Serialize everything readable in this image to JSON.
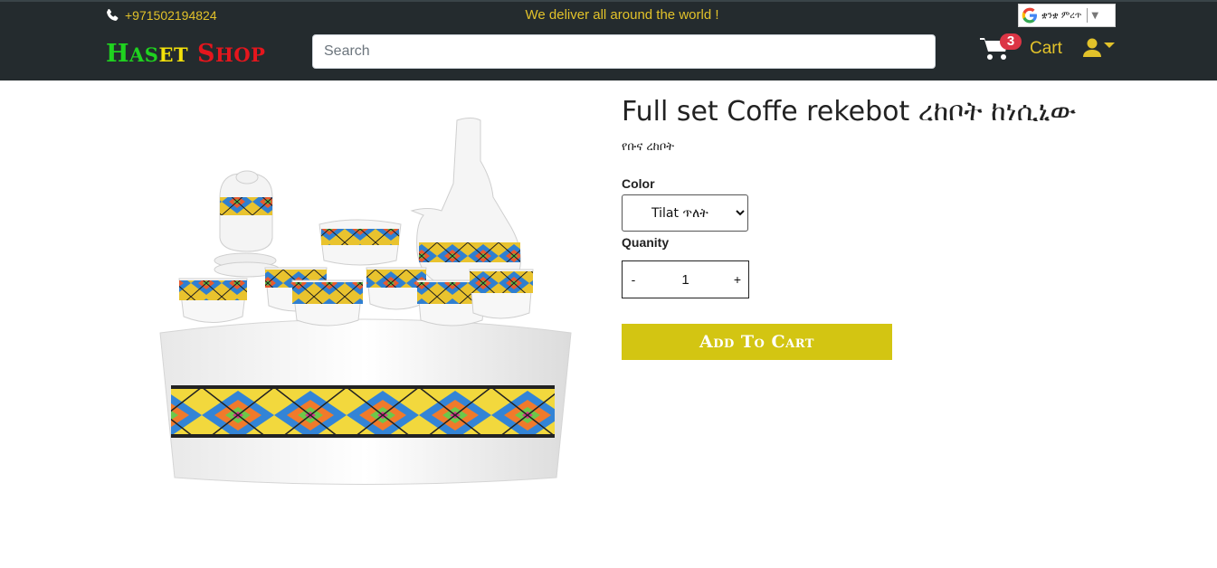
{
  "header": {
    "phone": "+971502194824",
    "tagline": "We deliver all around the world !",
    "translate": {
      "language": "ቋንቋ ምረጥ",
      "arrow": "▼"
    },
    "logo": {
      "part1_first": "H",
      "part1_rest": "AS",
      "part2_rest": "ET",
      "part3_first": " S",
      "part3_rest": "HOP"
    },
    "search": {
      "placeholder": "Search",
      "value": ""
    },
    "cart": {
      "count": "3",
      "label": "Cart"
    },
    "icons": [
      "phone-icon",
      "google-icon",
      "cart-icon",
      "user-icon",
      "caret-down-icon"
    ]
  },
  "product": {
    "title": "Full set Coffe rekebot ረከቦት ከነሲኒው",
    "subtitle": "የቡና ረከቦት",
    "color_label": "Color",
    "color_selected": "Tilat ጥለት",
    "quantity_label": "Quanity",
    "quantity_value": "1",
    "minus": "-",
    "plus": "+",
    "add_to_cart": "Add To Cart"
  },
  "colors": {
    "topbar": "#242b2e",
    "accent": "#e2c22a",
    "button": "#d3c512",
    "badge": "#dc3545"
  }
}
